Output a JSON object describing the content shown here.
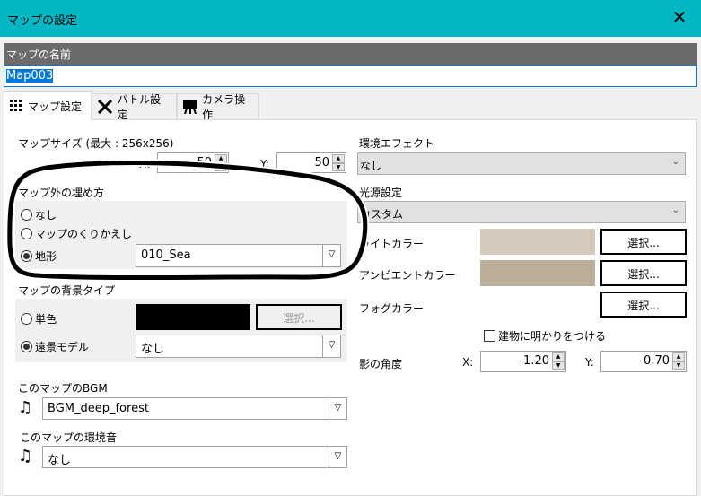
{
  "window": {
    "title": "マップの設定",
    "close": "✕"
  },
  "map_name": {
    "label": "マップの名前",
    "value": "Map003"
  },
  "tabs": [
    {
      "label": "マップ設定",
      "icon": "grid-icon"
    },
    {
      "label": "バトル設定",
      "icon": "crossed-swords-icon"
    },
    {
      "label": "カメラ操作",
      "icon": "camera-icon"
    }
  ],
  "map_size": {
    "label": "マップサイズ (最大 : 256x256)",
    "x_label": "X:",
    "x": "50",
    "y_label": "Y:",
    "y": "50"
  },
  "fill": {
    "label": "マップ外の埋め方",
    "options": [
      "なし",
      "マップのくりかえし",
      "地形"
    ],
    "selected": 2,
    "terrain": "010_Sea"
  },
  "background": {
    "label": "マップの背景タイプ",
    "solid": "単色",
    "solid_color": "#000000",
    "select": "選択...",
    "distant": "遠景モデル",
    "distant_value": "なし"
  },
  "bgm": {
    "label": "このマップのBGM",
    "value": "BGM_deep_forest"
  },
  "ambient": {
    "label": "このマップの環境音",
    "value": "なし"
  },
  "effect": {
    "label": "環境エフェクト",
    "value": "なし"
  },
  "light": {
    "label": "光源設定",
    "value": "カスタム",
    "light_color_label": "ライトカラー",
    "light_color": "#d6cabc",
    "ambient_color_label": "アンビエントカラー",
    "ambient_color": "#bbae9b",
    "fog_color_label": "フォグカラー",
    "select": "選択..."
  },
  "building_light": {
    "label": "建物に明かりをつける",
    "checked": false
  },
  "shadow": {
    "label": "影の角度",
    "x_label": "X:",
    "x": "-1.20",
    "y_label": "Y:",
    "y": "-0.70"
  }
}
